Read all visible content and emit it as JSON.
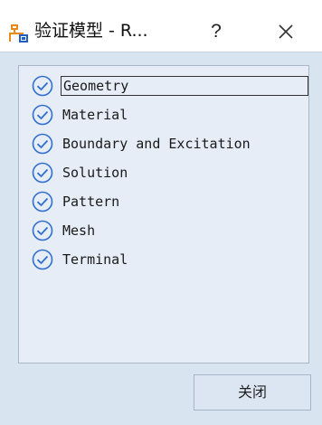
{
  "window": {
    "title": "验证模型 - R...",
    "help_label": "?",
    "icons": {
      "app": "network-icon",
      "close": "close-icon",
      "check": "check-circle-icon"
    },
    "colors": {
      "accent": "#2f6fd0",
      "app_icon_orange": "#e8891c",
      "app_icon_blue": "#1f5fbf"
    }
  },
  "checklist": {
    "items": [
      {
        "label": "Geometry",
        "selected": true
      },
      {
        "label": "Material"
      },
      {
        "label": "Boundary and Excitation"
      },
      {
        "label": "Solution"
      },
      {
        "label": "Pattern"
      },
      {
        "label": "Mesh"
      },
      {
        "label": "Terminal"
      }
    ]
  },
  "footer": {
    "close_label": "关闭"
  }
}
